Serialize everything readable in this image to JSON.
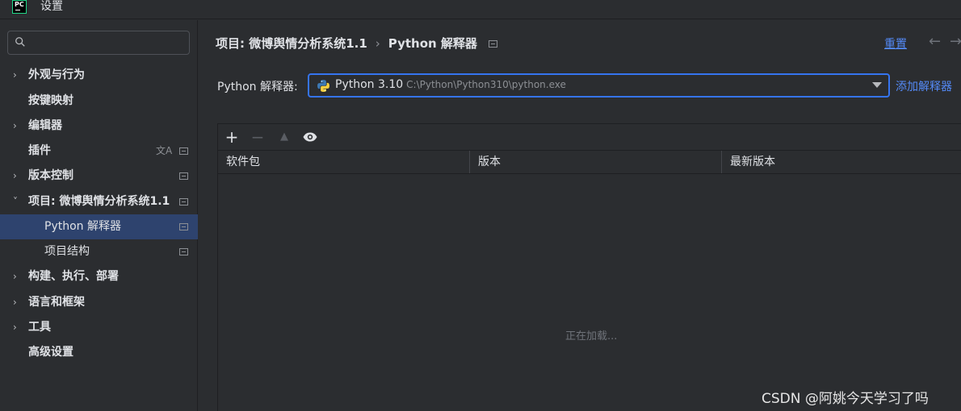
{
  "window": {
    "logo_text": "PC",
    "title": "设置"
  },
  "sidebar": {
    "search_placeholder": "",
    "items": [
      {
        "label": "外观与行为",
        "expand": "›"
      },
      {
        "label": "按键映射"
      },
      {
        "label": "编辑器",
        "expand": "›"
      },
      {
        "label": "插件"
      },
      {
        "label": "版本控制",
        "expand": "›"
      },
      {
        "label": "项目: 微博舆情分析系统1.1",
        "expand": "˅"
      },
      {
        "label": "Python 解释器"
      },
      {
        "label": "项目结构"
      },
      {
        "label": "构建、执行、部署",
        "expand": "›"
      },
      {
        "label": "语言和框架",
        "expand": "›"
      },
      {
        "label": "工具",
        "expand": "›"
      },
      {
        "label": "高级设置"
      }
    ]
  },
  "main": {
    "breadcrumb": {
      "project": "项目: 微博舆情分析系统1.1",
      "separator": "›",
      "current": "Python 解释器"
    },
    "reset_label": "重置",
    "back_icon": "←",
    "forward_icon": "→",
    "interpreter": {
      "label": "Python 解释器:",
      "name": "Python 3.10",
      "path": "C:\\Python\\Python310\\python.exe",
      "add_label": "添加解释器"
    },
    "toolbar": {
      "add": "+",
      "remove": "−",
      "up": "▲"
    },
    "table": {
      "columns": [
        "软件包",
        "版本",
        "最新版本"
      ],
      "loading_text": "正在加载..."
    }
  },
  "watermark": "CSDN @阿姚今天学习了吗",
  "colors": {
    "background": "#2b2d30",
    "selection": "#2e436e",
    "accent": "#3574f0",
    "link": "#548af7"
  }
}
